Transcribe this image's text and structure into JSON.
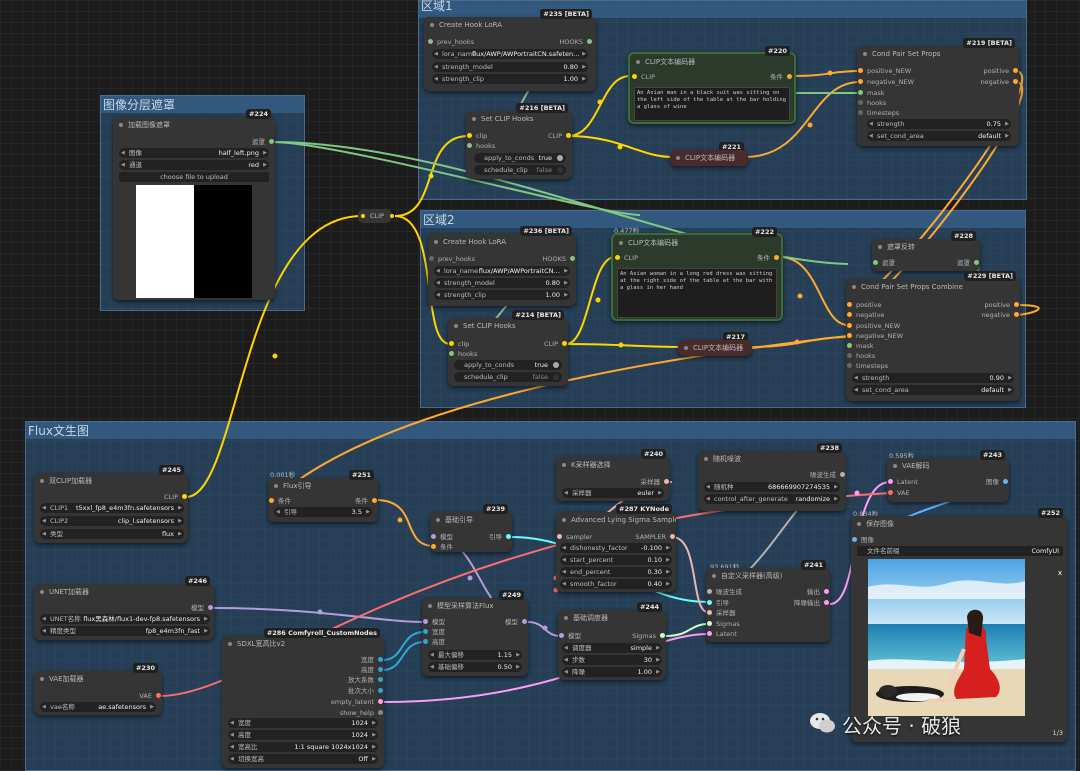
{
  "groups": {
    "g1": "区域1",
    "g2": "区域2",
    "g3": "图像分层遮罩",
    "g4": "Flux文生图"
  },
  "nodes": {
    "n235": {
      "id": "#235 [BETA]",
      "title": "Create Hook LoRA",
      "prev": "prev_hooks",
      "out": "HOOKS",
      "lora_name": "lora_name",
      "lora_val": "flux/AWP/AWPortraitCN.safeten…",
      "sm": "strength_model",
      "sm_v": "0.80",
      "sc": "strength_clip",
      "sc_v": "1.00"
    },
    "n220": {
      "id": "#220",
      "title": "CLIP文本编码器",
      "in": "CLIP",
      "out": "条件",
      "text": "An Asian man in a black suit was sitting on the left side of the table at the bar holding a glass of wine"
    },
    "n219": {
      "id": "#219 [BETA]",
      "title": "Cond Pair Set Props",
      "in1": "positive_NEW",
      "in2": "negative_NEW",
      "in3": "mask",
      "in4": "hooks",
      "in5": "timesteps",
      "out1": "positive",
      "out2": "negative",
      "w1": "strength",
      "w1v": "0.75",
      "w2": "set_cond_area",
      "w2v": "default"
    },
    "n216": {
      "id": "#216 [BETA]",
      "title": "Set CLIP Hooks",
      "in1": "clip",
      "in2": "hooks",
      "out": "CLIP",
      "t1": "apply_to_conds",
      "t1v": "true",
      "t2": "schedule_clip",
      "t2v": "false"
    },
    "n221": {
      "id": "#221",
      "title": "CLIP文本编码器"
    },
    "n224": {
      "id": "#224",
      "title": "加载图像遮罩",
      "out": "遮罩",
      "w1": "图像",
      "w1v": "half_left.png",
      "w2": "通道",
      "w2v": "red",
      "btn": "choose file to upload"
    },
    "reroute": {
      "label": "CLIP"
    },
    "n236": {
      "id": "#236 [BETA]",
      "title": "Create Hook LoRA",
      "prev": "prev_hooks",
      "out": "HOOKS",
      "lora_name": "lora_name",
      "lora_val": "flux/AWP/AWPortraitCN…",
      "sm": "strength_model",
      "sm_v": "0.80",
      "sc": "strength_clip",
      "sc_v": "1.00"
    },
    "n222": {
      "id": "#222",
      "title": "CLIP文本编码器",
      "time": "0.477秒",
      "in": "CLIP",
      "out": "条件",
      "text": "An Asian woman in a long red dress was sitting at the right side of the table at the bar with a glass in her hand"
    },
    "n228": {
      "id": "#228",
      "title": "遮罩反转",
      "in": "遮罩",
      "out": "遮罩"
    },
    "n229": {
      "id": "#229 [BETA]",
      "title": "Cond Pair Set Props Combine",
      "in1": "positive",
      "in2": "negative",
      "in3": "positive_NEW",
      "in4": "negative_NEW",
      "in5": "mask",
      "in6": "hooks",
      "in7": "timesteps",
      "out1": "positive",
      "out2": "negative",
      "w1": "strength",
      "w1v": "0.90",
      "w2": "set_cond_area",
      "w2v": "default"
    },
    "n214": {
      "id": "#214 [BETA]",
      "title": "Set CLIP Hooks",
      "in1": "clip",
      "in2": "hooks",
      "out": "CLIP",
      "t1": "apply_to_conds",
      "t1v": "true",
      "t2": "schedule_clip",
      "t2v": "false"
    },
    "n217": {
      "id": "#217",
      "title": "CLIP文本编码器"
    },
    "n245": {
      "id": "#245",
      "title": "双CLIP加载器",
      "out": "CLIP",
      "w1": "CLIP1",
      "w1v": "t5xxl_fp8_e4m3fn.safetensors",
      "w2": "CLIP2",
      "w2v": "clip_l.safetensors",
      "w3": "类型",
      "w3v": "flux"
    },
    "n251": {
      "id": "#251",
      "title": "Flux引导",
      "time": "0.001秒",
      "in": "条件",
      "out": "条件",
      "w1": "引导",
      "w1v": "3.5"
    },
    "n240": {
      "id": "#240",
      "title": "K采样器选择",
      "out": "采样器",
      "w1": "采样器",
      "w1v": "euler"
    },
    "n238": {
      "id": "#238",
      "title": "随机噪波",
      "out": "噪波生成",
      "w1": "随机种",
      "w1v": "686669907274535",
      "w2": "control_after_generate",
      "w2v": "randomize"
    },
    "n243": {
      "id": "#243",
      "title": "VAE解码",
      "time": "0.595秒",
      "in1": "Latent",
      "in2": "VAE",
      "out": "图像"
    },
    "n239": {
      "id": "#239",
      "title": "基础引导",
      "in1": "模型",
      "in2": "条件",
      "out": "引导"
    },
    "n287": {
      "id": "#287 KYNode",
      "title": "Advanced Lying Sigma Sampler",
      "in": "sampler",
      "out": "SAMPLER",
      "w1": "dishonesty_factor",
      "w1v": "-0.100",
      "w2": "start_percent",
      "w2v": "0.10",
      "w3": "end_percent",
      "w3v": "0.30",
      "w4": "smooth_factor",
      "w4v": "0.40"
    },
    "n252": {
      "id": "#252",
      "title": "保存图像",
      "time": "0.834秒",
      "in": "图像",
      "w1": "文件名前缀",
      "w1v": "ComfyUI",
      "count": "1/3",
      "close": "x"
    },
    "n241": {
      "id": "#241",
      "title": "自定义采样器(高级)",
      "time": "93.691秒",
      "in1": "噪波生成",
      "in2": "引导",
      "in3": "采样器",
      "in4": "Sigmas",
      "in5": "Latent",
      "out1": "输出",
      "out2": "降噪输出"
    },
    "n246": {
      "id": "#246",
      "title": "UNET加载器",
      "out": "模型",
      "w1": "UNET名称",
      "w1v": "flux黑森林/flux1-dev-fp8.safetensors",
      "w2": "精度类型",
      "w2v": "fp8_e4m3fn_fast"
    },
    "n249": {
      "id": "#249",
      "title": "模型采样算法Flux",
      "in1": "模型",
      "in2": "宽度",
      "in3": "高度",
      "out": "模型",
      "w1": "最大偏移",
      "w1v": "1.15",
      "w2": "基础偏移",
      "w2v": "0.50"
    },
    "n244": {
      "id": "#244",
      "title": "基础调度器",
      "in": "模型",
      "out": "Sigmas",
      "w1": "调度器",
      "w1v": "simple",
      "w2": "步数",
      "w2v": "30",
      "w3": "降噪",
      "w3v": "1.00"
    },
    "n286": {
      "id": "#286 Comfyroll_CustomNodes",
      "title": "SDXL宽高比v2",
      "out1": "宽度",
      "out2": "高度",
      "out3": "放大系数",
      "out4": "批次大小",
      "out5": "empty_latent",
      "out6": "show_help",
      "w1": "宽度",
      "w1v": "1024",
      "w2": "高度",
      "w2v": "1024",
      "w3": "宽高比",
      "w3v": "1:1 square 1024x1024",
      "w4": "切换宽高",
      "w4v": "Off"
    },
    "n230": {
      "id": "#230",
      "title": "VAE加载器",
      "out": "VAE",
      "w1": "vae名称",
      "w1v": "ae.safetensors"
    }
  },
  "watermark": "公众号 · 破狼",
  "colors": {
    "clip": "#ffd500",
    "cond": "#ffa931",
    "model": "#b39ddb",
    "latent": "#ff9cf9",
    "vae": "#ff6e6e",
    "mask": "#81c784",
    "image": "#64b5f6",
    "hooks": "#8fbc8f",
    "sigmas": "#cdffcd",
    "sampler": "#ecb4b4",
    "guider": "#66ffff",
    "noise": "#b0b0b0"
  }
}
